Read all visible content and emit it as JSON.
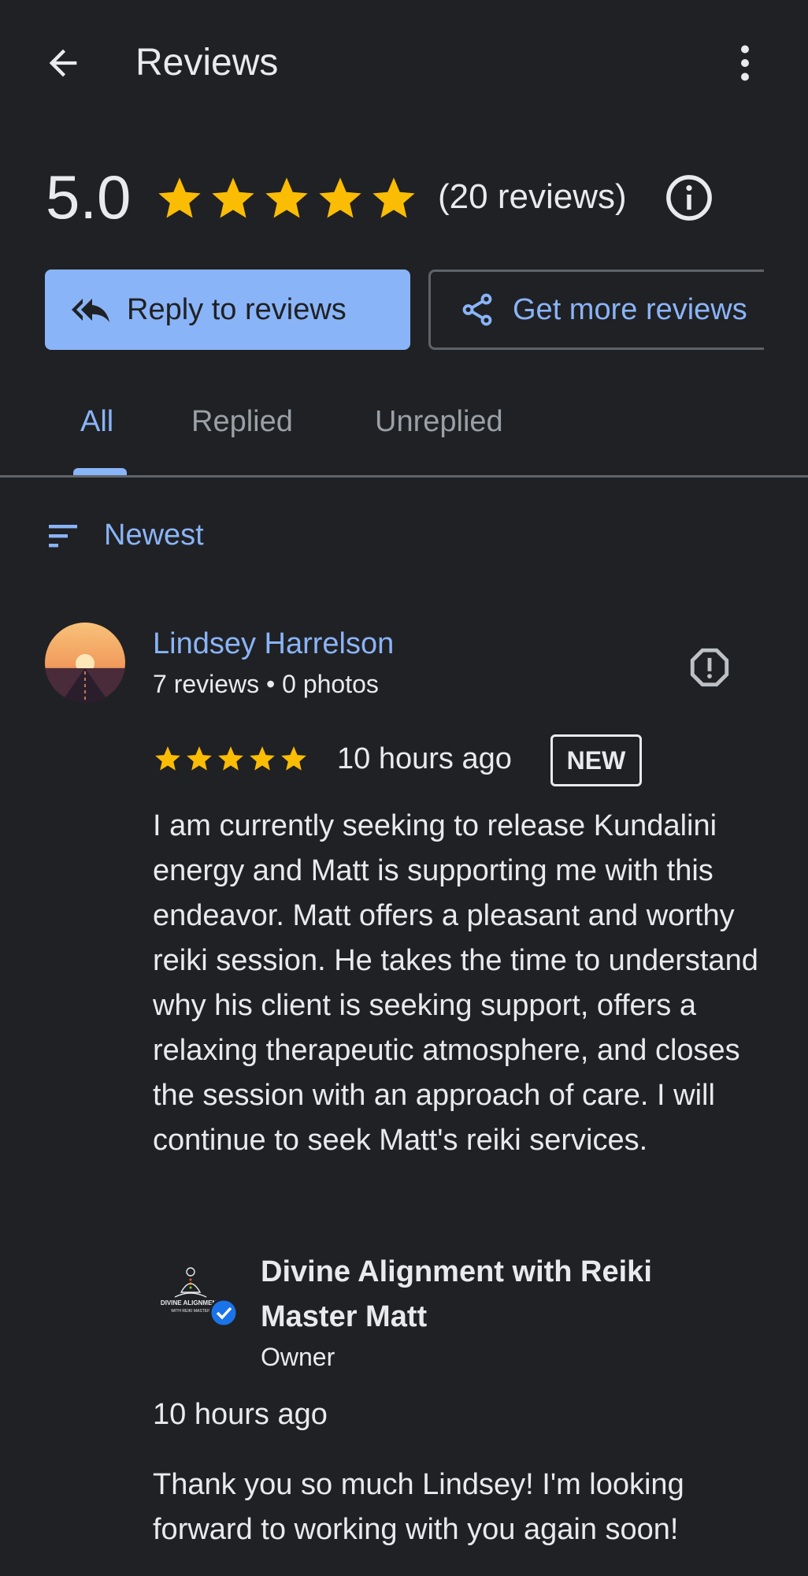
{
  "header": {
    "title": "Reviews",
    "back_icon": "arrow-back-icon",
    "more_icon": "more-vert-icon"
  },
  "summary": {
    "rating": "5.0",
    "stars": 5,
    "review_count": "(20 reviews)",
    "star_color": "#fbbc04"
  },
  "actions": {
    "reply_label": "Reply to reviews",
    "get_more_label": "Get more reviews",
    "accent_color": "#8ab4f8"
  },
  "tabs": [
    {
      "label": "All",
      "active": true
    },
    {
      "label": "Replied",
      "active": false
    },
    {
      "label": "Unreplied",
      "active": false
    }
  ],
  "sort": {
    "label": "Newest"
  },
  "review": {
    "author": "Lindsey Harrelson",
    "meta": "7 reviews • 0 photos",
    "stars": 5,
    "time": "10 hours ago",
    "badge": "NEW",
    "text": "I am currently seeking to release Kundalini energy and Matt is supporting me with this endeavor. Matt offers a pleasant and worthy reiki session. He takes the time to understand why his client is seeking support, offers a relaxing therapeutic atmosphere, and closes the session with an approach of care. I will continue to seek Matt's reiki services."
  },
  "owner_reply": {
    "name": "Divine Alignment with Reiki Master Matt",
    "role": "Owner",
    "time": "10 hours ago",
    "text": "Thank you so much Lindsey! I'm looking forward to working with you again soon!",
    "logo_text": "DIVINE ALIGNMENT",
    "logo_subtext": "WITH REIKI MASTER"
  }
}
